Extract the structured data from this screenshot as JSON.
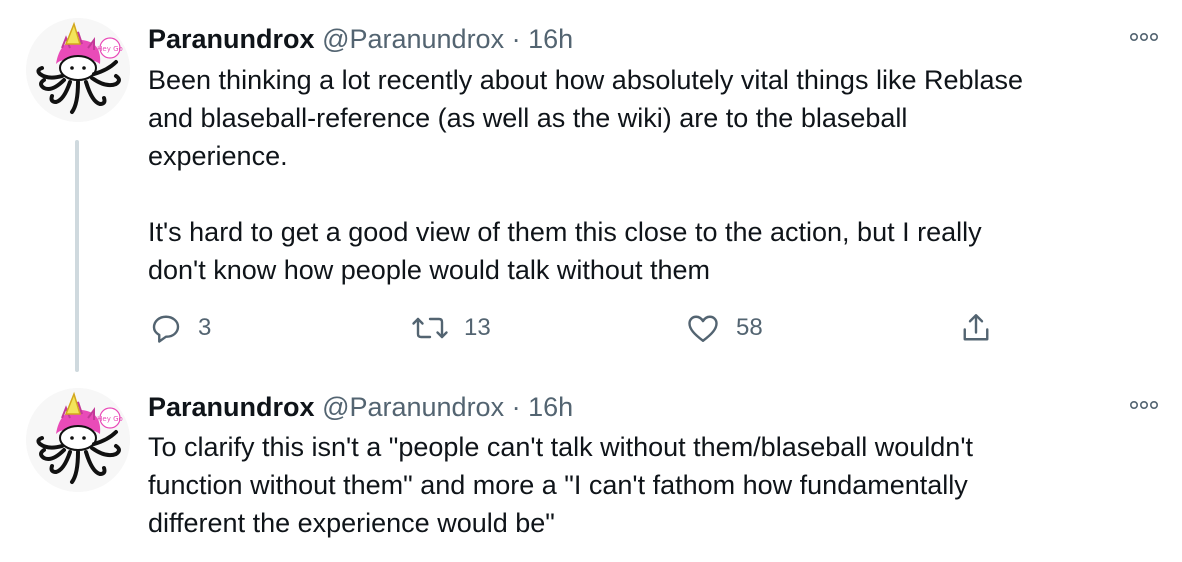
{
  "tweets": [
    {
      "display_name": "Paranundrox",
      "handle": "@Paranundrox",
      "separator": "·",
      "time": "16h",
      "text": "Been thinking a lot recently about how absolutely vital things like Reblase\nand blaseball-reference (as well as the wiki) are to the blaseball\nexperience.\n\nIt's hard to get a good view of them this close to the action, but I really\ndon't know how people would talk without them",
      "replies": "3",
      "retweets": "13",
      "likes": "58"
    },
    {
      "display_name": "Paranundrox",
      "handle": "@Paranundrox",
      "separator": "·",
      "time": "16h",
      "text": "To clarify this isn't a \"people can't talk without them/blaseball wouldn't\nfunction without them\" and more a \"I can't fathom how fundamentally\ndifferent the experience would be\""
    }
  ],
  "avatar_sticker_text": "Hey Go",
  "colors": {
    "text": "#0f1419",
    "secondary": "#536471",
    "thread_line": "#cfd9de",
    "avatar_pink": "#e94bb8"
  },
  "icons": [
    "more-icon",
    "reply-icon",
    "retweet-icon",
    "like-icon",
    "share-icon"
  ]
}
